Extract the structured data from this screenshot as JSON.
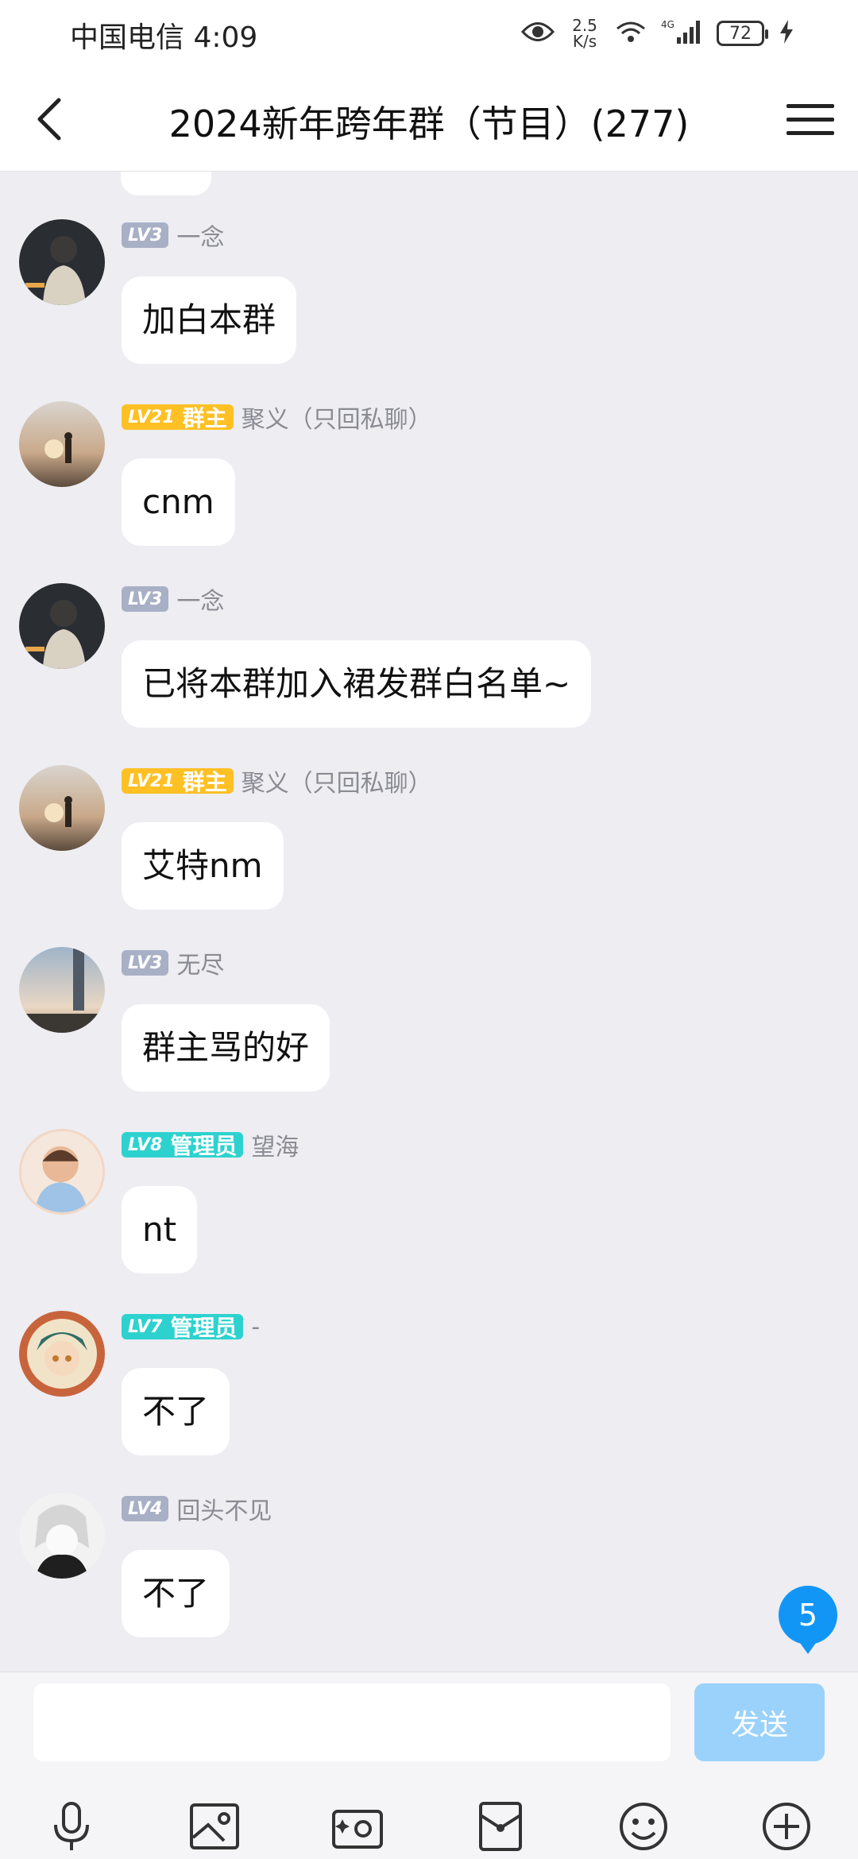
{
  "status_bar": {
    "carrier_time": "中国电信 4:09",
    "speed_top": "2.5",
    "speed_bottom": "K/s",
    "network": "4G",
    "battery": "72"
  },
  "header": {
    "title": "2024新年跨年群（节目）(277)"
  },
  "messages": [
    {
      "level": "LV3",
      "role": "",
      "name": "一念",
      "text": "加白本群"
    },
    {
      "level": "LV21",
      "role": "群主",
      "name": "聚义（只回私聊）",
      "text": "cnm"
    },
    {
      "level": "LV3",
      "role": "",
      "name": "一念",
      "text": "已将本群加入裙发群白名单~"
    },
    {
      "level": "LV21",
      "role": "群主",
      "name": "聚义（只回私聊）",
      "text": "艾特nm"
    },
    {
      "level": "LV3",
      "role": "",
      "name": "无尽",
      "text": "群主骂的好"
    },
    {
      "level": "LV8",
      "role": "管理员",
      "name": "望海",
      "text": "nt"
    },
    {
      "level": "LV7",
      "role": "管理员",
      "name": "-",
      "text": "不了"
    },
    {
      "level": "LV4",
      "role": "",
      "name": "回头不见",
      "text": "不了"
    }
  ],
  "unread_badge": "5",
  "input": {
    "placeholder": "",
    "send_label": "发送"
  },
  "colors": {
    "background": "#EDEDF2",
    "owner_badge": "#FFC024",
    "admin_badge": "#2DD2CF",
    "member_badge": "#A8B0C6",
    "send_button": "#9AD2FB",
    "unread_badge": "#1296F5"
  },
  "toolbar_icons": [
    "microphone-icon",
    "image-icon",
    "camera-icon",
    "red-packet-icon",
    "emoji-icon",
    "plus-icon"
  ]
}
